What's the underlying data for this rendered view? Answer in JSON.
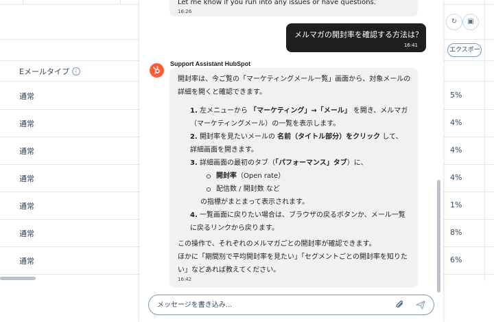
{
  "background": {
    "column_header": "Eメールタイプ",
    "info_icon": "info-icon",
    "export_label": "エクスポート",
    "rows": [
      {
        "type": "通常",
        "pct": "5%"
      },
      {
        "type": "通常",
        "pct": "4%"
      },
      {
        "type": "通常",
        "pct": "4%"
      },
      {
        "type": "通常",
        "pct": "4%"
      },
      {
        "type": "通常",
        "pct": "1%"
      },
      {
        "type": "通常",
        "pct": "8%"
      },
      {
        "type": "通常",
        "pct": "6%"
      }
    ]
  },
  "chat": {
    "prev_message": {
      "text": "Let me know if you run into any issues or have questions.",
      "time": "16:26"
    },
    "user_message": {
      "text": "メルマガの開封率を確認する方法は？",
      "time": "16:41"
    },
    "bot": {
      "sender": "Support Assistant HubSpot",
      "intro": "開封率は、今ご覧の「マーケティングメール一覧」画面から、対象メールの詳細を開くと確認できます。",
      "steps": [
        {
          "num": "1.",
          "pre": "左メニューから ",
          "bold": "「マーケティング」→「メール」",
          "post": " を開き、メルマガ（マーケティングメール）の一覧を表示します。"
        },
        {
          "num": "2.",
          "pre": "開封率を見たいメールの ",
          "bold": "名前（タイトル部分）をクリック",
          "post": " して、詳細画面を開きます。"
        },
        {
          "num": "3.",
          "pre": "詳細画面の最初のタブ（",
          "bold": "「パフォーマンス」タブ",
          "post": "）に、"
        },
        {
          "num": "4.",
          "pre": "一覧画面に戻りたい場合は、ブラウザの戻るボタンか、メール一覧に戻るリンクから戻ります。",
          "bold": "",
          "post": ""
        }
      ],
      "sub_items": [
        {
          "bold": "開封率",
          "text": "（Open rate）"
        },
        {
          "bold": "",
          "text": "配信数 / 開封数 など"
        }
      ],
      "sub_after": "の指標がまとまって表示されます。",
      "closing_1": "この操作で、それぞれのメルマガごとの開封率が確認できます。",
      "closing_2": "ほかに「期間別で平均開封率を見たい」「セグメントごとの開封率を知りたい」などあれば教えてください。",
      "time": "16:42"
    },
    "composer": {
      "placeholder": "メッセージを書き込み..."
    }
  },
  "colors": {
    "accent": "#ff5c35",
    "user_bubble": "#1f1f1f",
    "bot_bubble": "#f1f1f1"
  }
}
